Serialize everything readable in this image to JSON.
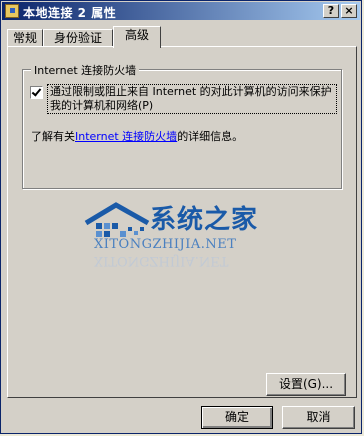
{
  "window": {
    "title": "本地连接 2 属性"
  },
  "titlebar": {
    "help_label": "?",
    "close_label": "×"
  },
  "tabs": [
    {
      "label": "常规"
    },
    {
      "label": "身份验证"
    },
    {
      "label": "高级"
    }
  ],
  "active_tab": "高级",
  "firewall_group": {
    "title": "Internet 连接防火墙",
    "checkbox_checked": true,
    "checkbox_label": "通过限制或阻止来自 Internet 的对此计算机的访问来保护我的计算机和网络(P)",
    "info_prefix": "了解有关",
    "info_link": "Internet 连接防火墙",
    "info_suffix": "的详细信息。"
  },
  "watermark": {
    "brand": "系统之家",
    "url": "XITONGZHIJIA.NET"
  },
  "buttons": {
    "settings": "设置(G)...",
    "ok": "确定",
    "cancel": "取消"
  }
}
